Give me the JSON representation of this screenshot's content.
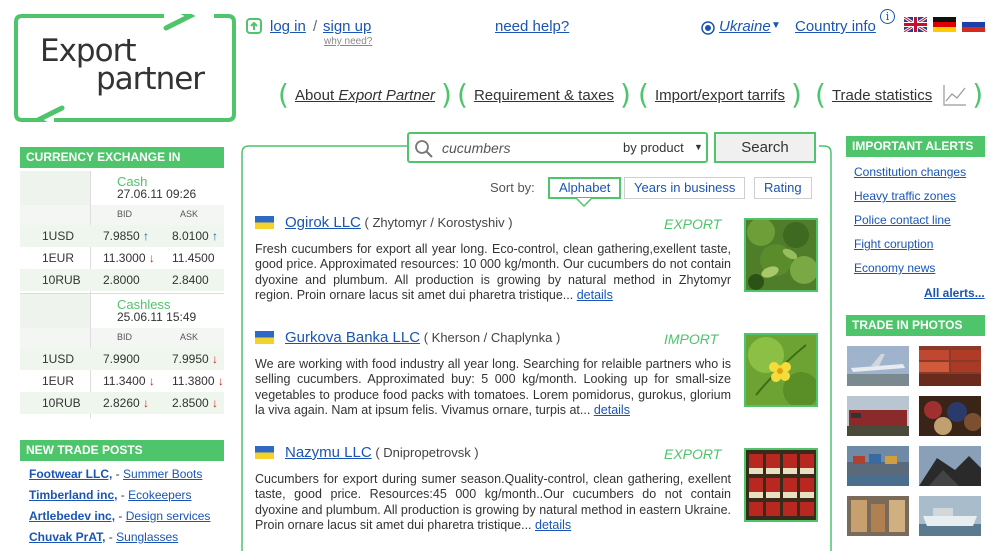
{
  "brand": {
    "line1": "Export",
    "line2": "partner"
  },
  "topbar": {
    "login": "log in",
    "slash": "/",
    "signup": "sign up",
    "why": "why need?",
    "help": "need help?",
    "country": "Ukraine",
    "country_info": "Country info",
    "info_badge": "i"
  },
  "nav": [
    {
      "label": "About Export Partner"
    },
    {
      "label": "Requirement & taxes"
    },
    {
      "label": "Import/export tarrifs"
    },
    {
      "label": "Trade statistics"
    }
  ],
  "currency": {
    "title": "CURRENCY EXCHANGE IN UKRAINE",
    "cash": {
      "label": "Cash",
      "date": "27.06.11 09:26"
    },
    "cashless": {
      "label": "Cashless",
      "date": "25.06.11 15:49"
    },
    "bid": "BID",
    "ask": "ASK",
    "cash_rows": [
      {
        "ccy": "1USD",
        "bid": "7.9850",
        "bid_dir": "up",
        "ask": "8.0100",
        "ask_dir": "up"
      },
      {
        "ccy": "1EUR",
        "bid": "11.3000",
        "bid_dir": "down",
        "ask": "11.4500",
        "ask_dir": ""
      },
      {
        "ccy": "10RUB",
        "bid": "2.8000",
        "bid_dir": "",
        "ask": "2.8400",
        "ask_dir": ""
      }
    ],
    "cashless_rows": [
      {
        "ccy": "1USD",
        "bid": "7.9900",
        "bid_dir": "",
        "ask": "7.9950",
        "ask_dir": "down"
      },
      {
        "ccy": "1EUR",
        "bid": "11.3400",
        "bid_dir": "down",
        "ask": "11.3800",
        "ask_dir": "down"
      },
      {
        "ccy": "10RUB",
        "bid": "2.8260",
        "bid_dir": "down",
        "ask": "2.8500",
        "ask_dir": "down"
      }
    ]
  },
  "trade_posts": {
    "title": "NEW TRADE POSTS",
    "items": [
      {
        "company": "Footwear LLC,",
        "category": "Summer Boots"
      },
      {
        "company": "Timberland inc,",
        "category": "Ecokeepers"
      },
      {
        "company": "Artlebedev inc,",
        "category": "Design services"
      },
      {
        "company": "Chuvak PrAT,",
        "category": "Sunglasses"
      }
    ],
    "sep": "-"
  },
  "search": {
    "value": "cucumbers",
    "mode": "by product",
    "button": "Search"
  },
  "sort": {
    "label": "Sort by:",
    "options": [
      "Alphabet",
      "Years in business",
      "Rating"
    ],
    "active": "Alphabet"
  },
  "results": [
    {
      "name": "Ogirok LLC",
      "location": "( Zhytomyr / Korostyshiv )",
      "type": "EXPORT",
      "text": "Fresh cucumbers for export all year long. Eco-control, clean gathering,exellent taste, good price. Approximated resources: 10 000 kg/month. Our cucumbers do not contain dyoxine and plumbum. All production is growing by natural method in Zhytomyr region. Proin ornare lacus sit amet dui pharetra tristique...",
      "more": "details"
    },
    {
      "name": "Gurkova Banka LLC",
      "location": "( Kherson / Chaplynka )",
      "type": "IMPORT",
      "text": "We are working with food industry all year long. Searching for relaible partners who is selling cucumbers. Approximated buy: 5 000 kg/month. Looking up for small-size vegetables to produce food packs with tomatoes. Lorem pomidorus, gurokus, glorium la viva again. Nam at ipsum felis. Vivamus ornare, turpis at...",
      "more": "details"
    },
    {
      "name": "Nazymu LLC",
      "location": "( Dnipropetrovsk )",
      "type": "EXPORT",
      "text": "Cucumbers for export during sumer season.Quality-control, clean gathering, exellent taste, good price. Resources:45 000 kg/month..Our cucumbers do not contain dyoxine and plumbum. All production is growing by natural method in eastern Ukraine. Proin ornare lacus sit amet dui pharetra tristique...",
      "more": "details"
    }
  ],
  "alerts": {
    "title": "IMPORTANT ALERTS",
    "items": [
      "Constitution changes",
      "Heavy traffic zones",
      "Police contact line",
      "Fight coruption",
      "Economy news"
    ],
    "all": "All alerts..."
  },
  "photos": {
    "title": "TRADE IN PHOTOS"
  },
  "colors": {
    "accent": "#4ec46b",
    "link": "#1a55b5",
    "down": "#d02020"
  }
}
